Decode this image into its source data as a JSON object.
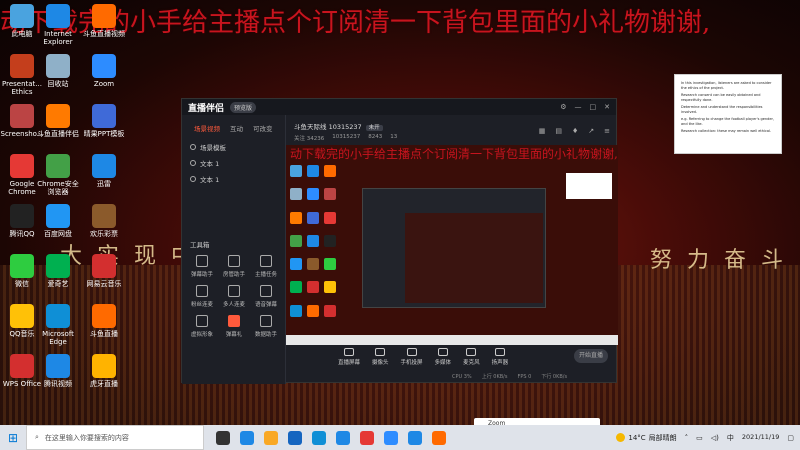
{
  "overlay": {
    "scroll_text": "动下载完的小手给主播点个订阅清一下背包里面的小礼物谢谢,",
    "banner_left": "大 实 现 中 华 民 族 伟",
    "banner_right": "努 力 奋 斗"
  },
  "desktop_icons": [
    {
      "label": "此电脑",
      "color": "#4aa3df"
    },
    {
      "label": "Internet Explorer",
      "color": "#1e88e5"
    },
    {
      "label": "斗鱼直播视频",
      "color": "#ff6a00"
    },
    {
      "label": "Presentat... Ethics",
      "color": "#c43e1c"
    },
    {
      "label": "回收站",
      "color": "#8fb0c8"
    },
    {
      "label": "Zoom",
      "color": "#2d8cff"
    },
    {
      "label": "Screensho...",
      "color": "#b44"
    },
    {
      "label": "斗鱼直播伴侣",
      "color": "#ff7a00"
    },
    {
      "label": "晴果PPT模板",
      "color": "#3f6ad8"
    },
    {
      "label": "Google Chrome",
      "color": "#e53935"
    },
    {
      "label": "Chrome安全浏览器",
      "color": "#43a047"
    },
    {
      "label": "迅雷",
      "color": "#1e88e5"
    },
    {
      "label": "腾讯QQ",
      "color": "#222"
    },
    {
      "label": "百度网盘",
      "color": "#2196f3"
    },
    {
      "label": "欢乐彩票",
      "color": "#8b5a2b"
    },
    {
      "label": "微信",
      "color": "#2ecc40"
    },
    {
      "label": "爱奇艺",
      "color": "#00b050"
    },
    {
      "label": "网易云音乐",
      "color": "#d32f2f"
    },
    {
      "label": "QQ音乐",
      "color": "#ffc107"
    },
    {
      "label": "Microsoft Edge",
      "color": "#0f8fd6"
    },
    {
      "label": "斗鱼直播",
      "color": "#ff6a00"
    },
    {
      "label": "WPS Office",
      "color": "#d32f2f"
    },
    {
      "label": "腾讯视频",
      "color": "#1e88e5"
    },
    {
      "label": "虎牙直播",
      "color": "#ffb300"
    }
  ],
  "note": {
    "lines": [
      "In this investigation, listeners are asked to consider the ethics of the project.",
      "Research consent can be easily obtained and respectfully done.",
      "Determine and understand the responsibilities involved.",
      "e.g. Referring to change the football player's gender, and the like.",
      "Research collection: these may remain well ethical."
    ]
  },
  "app": {
    "title": "直播伴侣",
    "version": "预览版",
    "left_tabs": [
      "场景视频",
      "互动",
      "可改变"
    ],
    "scenes": [
      "场景模板",
      "文本 1",
      "文本 1"
    ],
    "tools_title": "工具箱",
    "tools": [
      {
        "label": "弹幕助手",
        "hot": false
      },
      {
        "label": "房管助手",
        "hot": false
      },
      {
        "label": "主播任务",
        "hot": false
      },
      {
        "label": "粉丝连麦",
        "hot": false
      },
      {
        "label": "多人连麦",
        "hot": false
      },
      {
        "label": "语音弹幕",
        "hot": false
      },
      {
        "label": "虚拟形象",
        "hot": false
      },
      {
        "label": "弹幕礼",
        "hot": true
      },
      {
        "label": "数据助手",
        "hot": false
      }
    ],
    "room_title": "斗鱼天际线 10315237",
    "room_tag": "未开",
    "room_sub": [
      "关注 34236",
      "10315237",
      "8243",
      "13"
    ],
    "bottom_actions": [
      "直播屏幕",
      "摄像头",
      "手机投屏",
      "多媒体",
      "麦克风",
      "扬声器"
    ],
    "start_label": "开始直播",
    "status": [
      "CPU 3%",
      "上行 0KB/s",
      "FPS 0",
      "下行 0KB/s"
    ]
  },
  "zoom_window": "Zoom",
  "taskbar": {
    "search_placeholder": "在这里输入你要搜索的内容",
    "weather_temp": "14°C",
    "weather_desc": "局部晴朗",
    "ime": "中",
    "time": "",
    "date": "2021/11/19",
    "apps": [
      "#333",
      "#1e88e5",
      "#f9a825",
      "#1565c0",
      "#0f8fd6",
      "#1e88e5",
      "#e53935",
      "#2d8cff",
      "#1e88e5",
      "#ff6a00"
    ]
  }
}
